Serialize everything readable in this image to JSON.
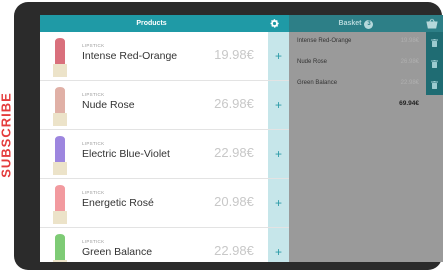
{
  "side_banner": {
    "text": "SUBSCRIBE"
  },
  "products_panel": {
    "title": "Products",
    "items": [
      {
        "type": "LIPSTICK",
        "name": "Intense Red-Orange",
        "price": "19.98€",
        "add": "+",
        "color": "#d9707c"
      },
      {
        "type": "LIPSTICK",
        "name": "Nude Rose",
        "price": "26.98€",
        "add": "+",
        "color": "#e0b0a6"
      },
      {
        "type": "LIPSTICK",
        "name": "Electric Blue-Violet",
        "price": "22.98€",
        "add": "+",
        "color": "#9d86df"
      },
      {
        "type": "LIPSTICK",
        "name": "Energetic Rosé",
        "price": "20.98€",
        "add": "+",
        "color": "#f29a9f"
      },
      {
        "type": "LIPSTICK",
        "name": "Green Balance",
        "price": "22.98€",
        "add": "+",
        "color": "#7ecb75"
      }
    ]
  },
  "basket_panel": {
    "title": "Basket",
    "count": "3",
    "items": [
      {
        "name": "Intense Red-Orange",
        "price": "19.98€"
      },
      {
        "name": "Nude Rose",
        "price": "26.98€"
      },
      {
        "name": "Green Balance",
        "price": "22.98€"
      }
    ],
    "total": "69.94€"
  },
  "colors": {
    "accent": "#1f9aa6",
    "basket_header": "#2d7f87",
    "delete": "#1f6c73",
    "subscribe": "#e43c3c"
  }
}
